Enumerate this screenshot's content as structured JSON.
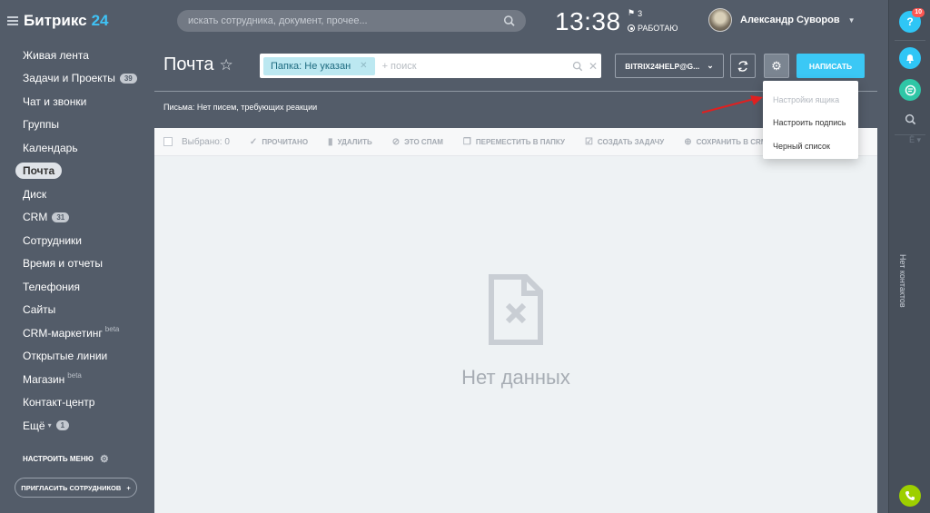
{
  "header": {
    "logo_main": "Битрикс",
    "logo_num": "24",
    "search_placeholder": "искать сотрудника, документ, прочее...",
    "clock": "13:38",
    "notifications": "3",
    "status": "РАБОТАЮ",
    "user_name": "Александр Суворов"
  },
  "sidebar": {
    "items": [
      {
        "label": "Живая лента"
      },
      {
        "label": "Задачи и Проекты",
        "count": "39"
      },
      {
        "label": "Чат и звонки"
      },
      {
        "label": "Группы"
      },
      {
        "label": "Календарь"
      },
      {
        "label": "Почта",
        "active": true
      },
      {
        "label": "Диск"
      },
      {
        "label": "CRM",
        "count": "31"
      },
      {
        "label": "Сотрудники"
      },
      {
        "label": "Время и отчеты"
      },
      {
        "label": "Телефония"
      },
      {
        "label": "Сайты"
      },
      {
        "label": "CRM-маркетинг",
        "sup": "beta"
      },
      {
        "label": "Открытые линии"
      },
      {
        "label": "Магазин",
        "sup": "beta"
      },
      {
        "label": "Контакт-центр"
      },
      {
        "label": "Ещё",
        "count": "1",
        "caret": true
      }
    ],
    "setup_menu": "НАСТРОИТЬ МЕНЮ",
    "invite": "ПРИГЛАСИТЬ СОТРУДНИКОВ"
  },
  "page": {
    "title": "Почта",
    "filter_tag": "Папка: Не указан",
    "filter_placeholder": "+ поиск",
    "mailbox": "BITRIX24HELP@G...",
    "write": "НАПИСАТЬ",
    "letters_status": "Письма: Нет писем, требующих реакции"
  },
  "toolbar": {
    "selected": "Выбрано: 0",
    "read": "ПРОЧИТАНО",
    "delete": "УДАЛИТЬ",
    "spam": "ЭТО СПАМ",
    "move": "ПЕРЕМЕСТИТЬ В ПАПКУ",
    "task": "СОЗДАТЬ ЗАДАЧУ",
    "save_crm": "СОХРАНИТЬ В CRM",
    "tail": "Ё"
  },
  "empty_state": "Нет данных",
  "dropdown": {
    "items": [
      "Настройки ящика",
      "Настроить подпись",
      "Черный список"
    ]
  },
  "rightbar": {
    "help_badge": "10",
    "no_contacts": "Нет контактов"
  },
  "colors": {
    "sidebar_bg": "#535c69",
    "accent": "#3bc8f5",
    "arrow": "#e02020"
  }
}
